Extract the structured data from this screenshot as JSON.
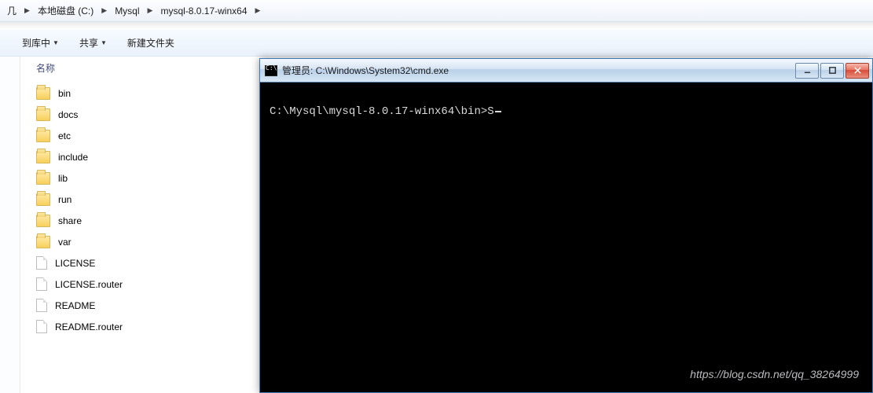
{
  "breadcrumb": {
    "first_partial": "几",
    "items": [
      {
        "label": "本地磁盘 (C:)"
      },
      {
        "label": "Mysql"
      },
      {
        "label": "mysql-8.0.17-winx64"
      }
    ]
  },
  "toolbar": {
    "tools": [
      {
        "label": "到库中",
        "has_caret": true
      },
      {
        "label": "共享",
        "has_caret": true
      },
      {
        "label": "新建文件夹",
        "has_caret": false
      }
    ]
  },
  "explorer": {
    "column_header": "名称",
    "items": [
      {
        "type": "folder",
        "name": "bin"
      },
      {
        "type": "folder",
        "name": "docs"
      },
      {
        "type": "folder",
        "name": "etc"
      },
      {
        "type": "folder",
        "name": "include"
      },
      {
        "type": "folder",
        "name": "lib"
      },
      {
        "type": "folder",
        "name": "run"
      },
      {
        "type": "folder",
        "name": "share"
      },
      {
        "type": "folder",
        "name": "var"
      },
      {
        "type": "file",
        "name": "LICENSE"
      },
      {
        "type": "file",
        "name": "LICENSE.router"
      },
      {
        "type": "file",
        "name": "README"
      },
      {
        "type": "file",
        "name": "README.router"
      }
    ]
  },
  "cmd": {
    "title": "管理员: C:\\Windows\\System32\\cmd.exe",
    "prompt_line": "C:\\Mysql\\mysql-8.0.17-winx64\\bin>S"
  },
  "watermark": "https://blog.csdn.net/qq_38264999"
}
